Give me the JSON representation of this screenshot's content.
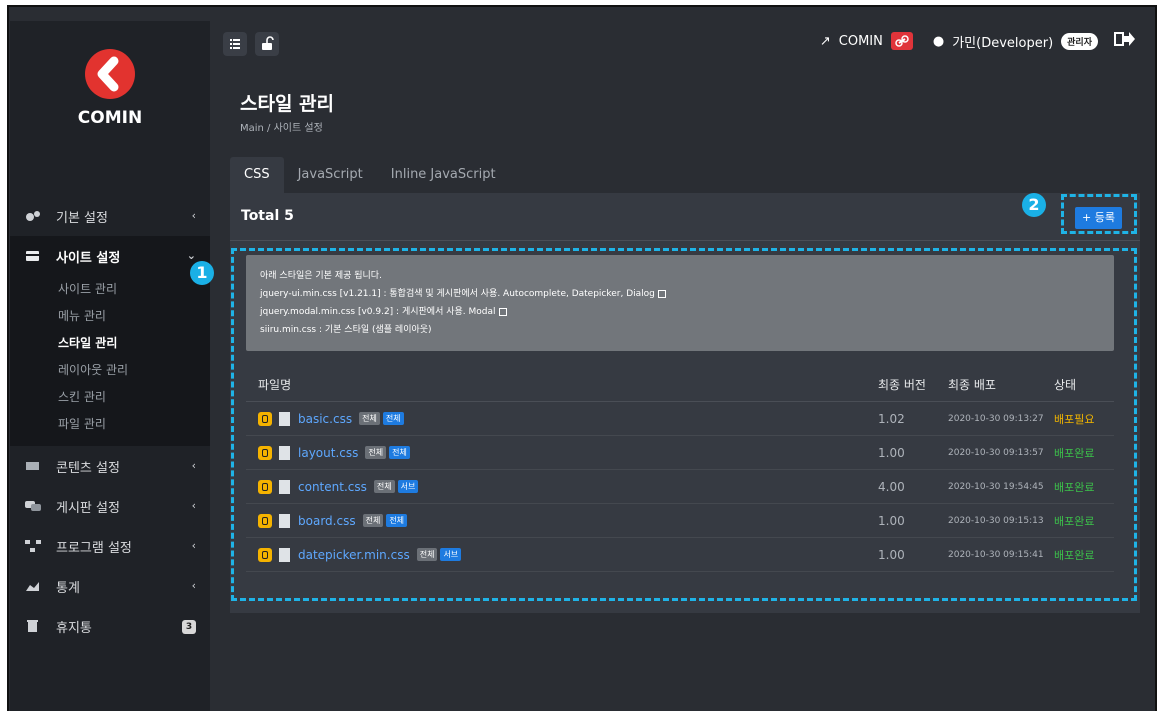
{
  "app": {
    "logo_text": "COMIN"
  },
  "header": {
    "site_link": "COMIN",
    "user": "가민(Developer)",
    "role_badge": "관리자"
  },
  "page": {
    "title": "스타일 관리",
    "breadcrumb": "Main  /  사이트 설정"
  },
  "sidebar": {
    "items": [
      {
        "label": "기본 설정",
        "icon": "gears-icon"
      },
      {
        "label": "사이트 설정",
        "icon": "site-icon",
        "active": true,
        "sub": [
          "사이트 관리",
          "메뉴 관리",
          "스타일 관리",
          "레이아웃 관리",
          "스킨 관리",
          "파일 관리"
        ]
      },
      {
        "label": "콘텐츠 설정",
        "icon": "content-icon"
      },
      {
        "label": "게시판 설정",
        "icon": "board-icon"
      },
      {
        "label": "프로그램 설정",
        "icon": "program-icon"
      },
      {
        "label": "통계",
        "icon": "chart-icon"
      },
      {
        "label": "휴지통",
        "icon": "trash-icon",
        "badge": "3"
      }
    ]
  },
  "tabs": [
    "CSS",
    "JavaScript",
    "Inline JavaScript"
  ],
  "panel": {
    "total": "Total 5",
    "register_label": "+ 등록"
  },
  "annotations": {
    "one": "1",
    "two": "2"
  },
  "notice": {
    "title": "아래 스타일은 기본 제공 됩니다.",
    "lines": [
      "jquery-ui.min.css [v1.21.1] : 통합검색 및 게시판에서 사용. Autocomplete, Datepicker, Dialog",
      "jquery.modal.min.css [v0.9.2] : 게시판에서 사용. Modal",
      "siiru.min.css : 기본 스타일 (샘플 레이아웃)"
    ]
  },
  "table": {
    "headers": {
      "name": "파일명",
      "version": "최종 버전",
      "deploy": "최종 배포",
      "status": "상태"
    },
    "rows": [
      {
        "name": "basic.css",
        "tag1": "전체",
        "tag2": "전체",
        "version": "1.02",
        "date": "2020-10-30 09:13:27",
        "status": "배포필요"
      },
      {
        "name": "layout.css",
        "tag1": "전체",
        "tag2": "전체",
        "version": "1.00",
        "date": "2020-10-30 09:13:57",
        "status": "배포완료"
      },
      {
        "name": "content.css",
        "tag1": "전체",
        "tag2": "서브",
        "version": "4.00",
        "date": "2020-10-30 19:54:45",
        "status": "배포완료"
      },
      {
        "name": "board.css",
        "tag1": "전체",
        "tag2": "전체",
        "version": "1.00",
        "date": "2020-10-30 09:15:13",
        "status": "배포완료"
      },
      {
        "name": "datepicker.min.css",
        "tag1": "전체",
        "tag2": "서브",
        "version": "1.00",
        "date": "2020-10-30 09:15:41",
        "status": "배포완료"
      }
    ]
  },
  "colors": {
    "accent": "#1e7be0",
    "annotation": "#1fb3e6",
    "brand": "#e2332f",
    "need": "#f0b400",
    "done": "#3cc04a"
  }
}
